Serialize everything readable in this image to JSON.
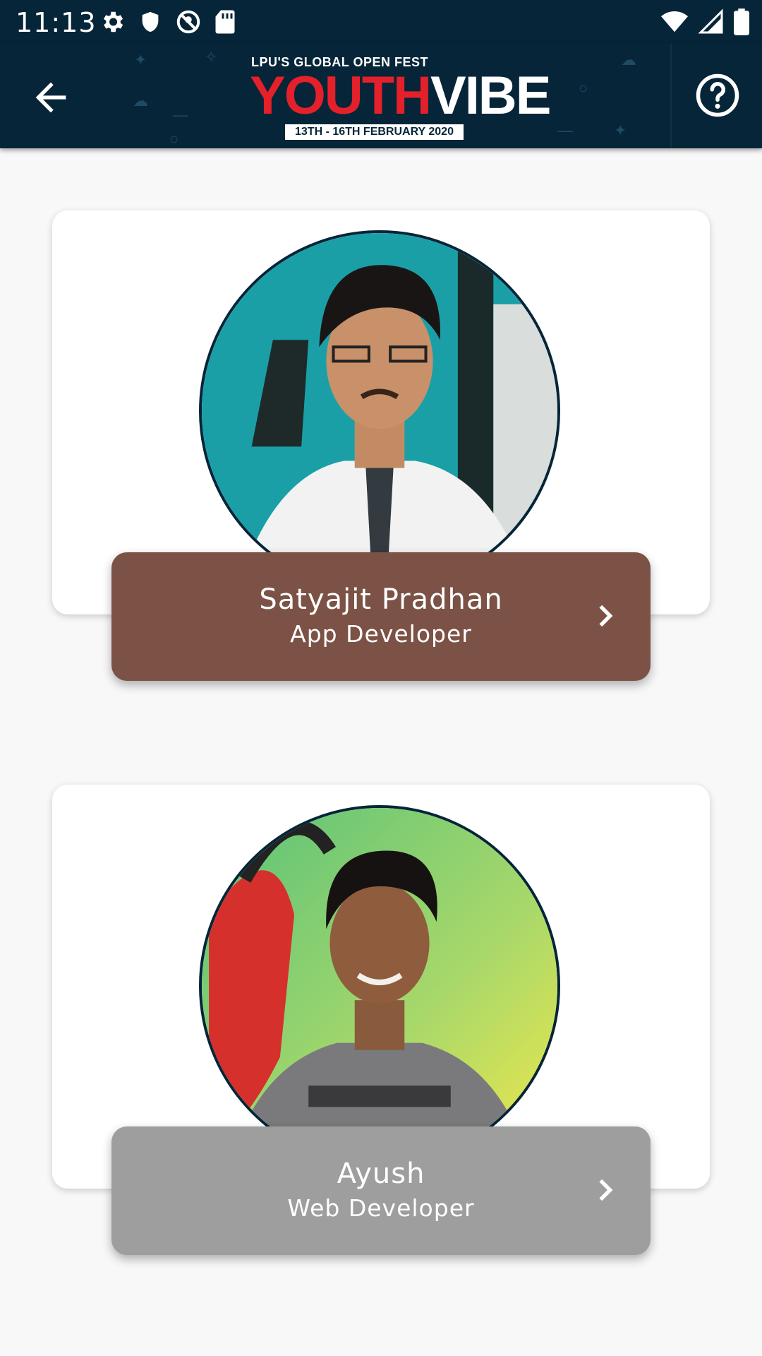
{
  "status_bar": {
    "time": "11:13",
    "left_icons": [
      "settings-icon",
      "shield-icon",
      "no-location-icon",
      "sd-card-icon"
    ],
    "right_icons": [
      "wifi-icon",
      "signal-icon",
      "battery-icon"
    ]
  },
  "app_bar": {
    "logo": {
      "tagline": "LPU'S GLOBAL OPEN FEST",
      "word_red": "YOUTH",
      "word_white": "VIBE",
      "dates": "13TH - 16TH FEBRUARY 2020"
    },
    "back_icon": "arrow-back-icon",
    "help_icon": "help-circle-icon"
  },
  "team": [
    {
      "name": "Satyajit Pradhan",
      "role": "App Developer",
      "banner_color": "#7b5245"
    },
    {
      "name": "Ayush",
      "role": "Web Developer",
      "banner_color": "#9e9e9e"
    }
  ],
  "colors": {
    "app_bar": "#062538",
    "accent_red": "#e4202b",
    "background": "#f8f8f8"
  }
}
